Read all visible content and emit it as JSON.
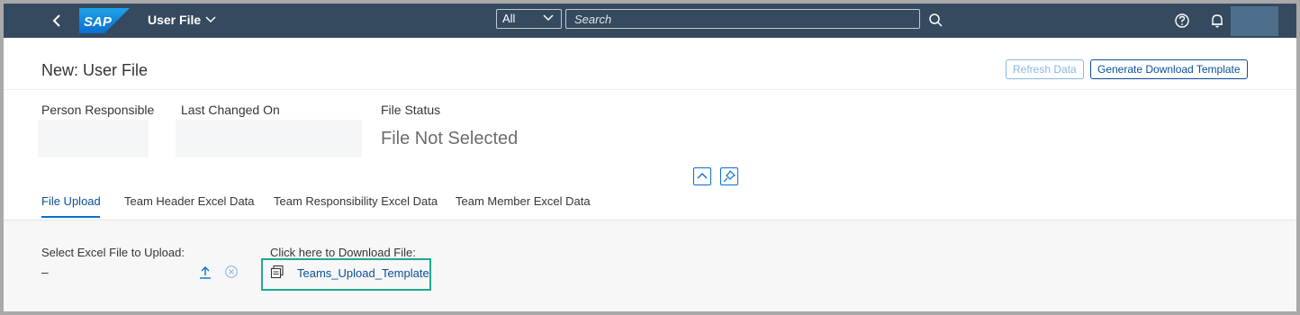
{
  "shell": {
    "app_title": "User File",
    "logo_text": "SAP",
    "search_scope": "All",
    "search_placeholder": "Search"
  },
  "header": {
    "title": "New: User File",
    "refresh_label": "Refresh Data",
    "generate_label": "Generate Download Template",
    "person_responsible_label": "Person Responsible",
    "last_changed_label": "Last Changed On",
    "file_status_label": "File Status",
    "file_status_value": "File Not Selected"
  },
  "tabs": [
    {
      "label": "File Upload"
    },
    {
      "label": "Team Header Excel Data"
    },
    {
      "label": "Team Responsibility Excel Data"
    },
    {
      "label": "Team Member Excel Data"
    }
  ],
  "content": {
    "select_label": "Select Excel File to Upload:",
    "select_value": "–",
    "download_label": "Click here to Download File:",
    "download_link": "Teams_Upload_Template"
  },
  "colors": {
    "shell": "#354a5f",
    "accent": "#0a6ed1",
    "highlight_box": "#1fa98c"
  },
  "icons": [
    "back-icon",
    "chevron-down-icon",
    "search-icon",
    "help-icon",
    "bell-icon",
    "collapse-icon",
    "pin-icon",
    "upload-icon",
    "clear-icon",
    "file-icon"
  ]
}
